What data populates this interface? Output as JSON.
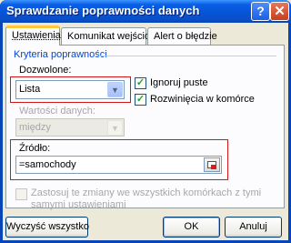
{
  "window": {
    "title": "Sprawdzanie poprawności danych",
    "help_glyph": "?",
    "close_glyph": "✕"
  },
  "tabs": [
    {
      "label": "Ustawienia",
      "active": true
    },
    {
      "label": "Komunikat wejściowy",
      "active": false
    },
    {
      "label": "Alert o błędzie",
      "active": false
    }
  ],
  "settings": {
    "group_title": "Kryteria poprawności",
    "allow_label": "Dozwolone:",
    "allow_value": "Lista",
    "ignore_blank_label": "Ignoruj puste",
    "ignore_blank_checked": true,
    "in_cell_dropdown_label": "Rozwinięcia w komórce",
    "in_cell_dropdown_checked": true,
    "data_label": "Wartości danych:",
    "data_value": "między",
    "source_label": "Źródło:",
    "source_value": "=samochody",
    "apply_all_label": "Zastosuj te zmiany we wszystkich komórkach z tymi samymi ustawieniami",
    "apply_all_checked": false
  },
  "buttons": {
    "clear_all": "Wyczyść wszystko",
    "ok": "OK",
    "cancel": "Anuluj"
  },
  "colors": {
    "highlight_border": "#d41616",
    "group_title": "#0046d5",
    "titlebar": "#0a5fe5"
  }
}
